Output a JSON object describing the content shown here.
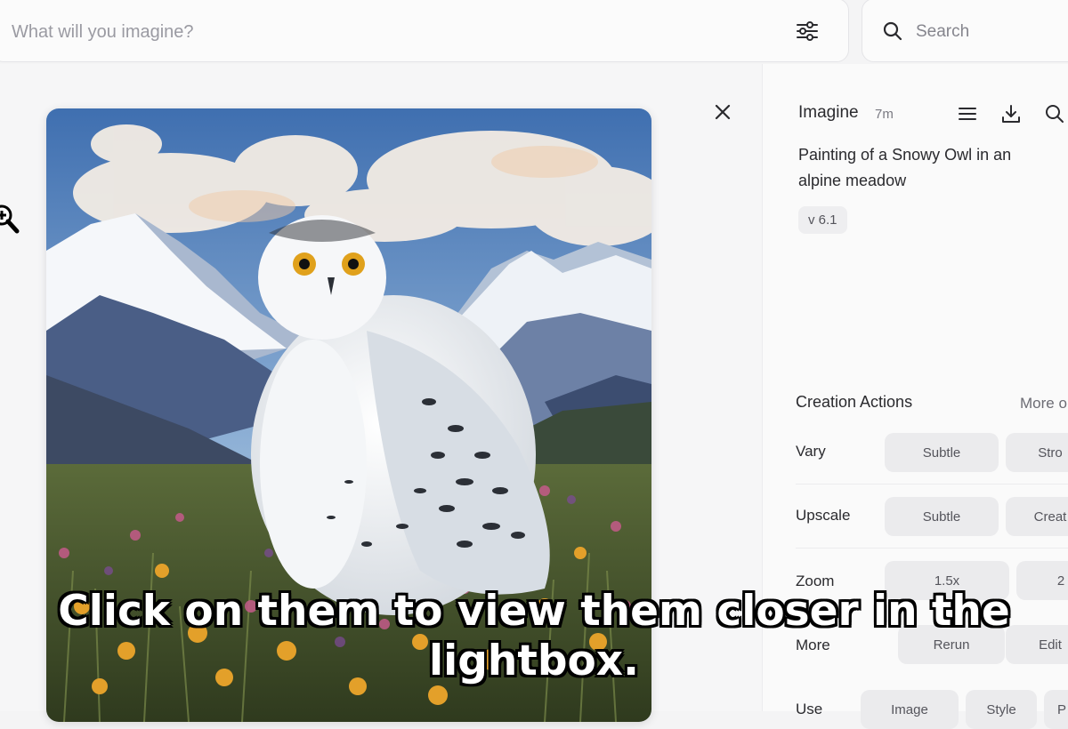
{
  "prompt_bar": {
    "placeholder": "What will you imagine?",
    "settings_icon": "sliders-icon"
  },
  "search": {
    "placeholder": "Search",
    "icon": "search-icon"
  },
  "lightbox": {
    "close_icon": "close-icon",
    "cursor_icon": "zoom-in-cursor-icon",
    "image_subject": "snowy owl painting"
  },
  "details": {
    "job_type": "Imagine",
    "job_age": "7m",
    "icons": [
      "menu-icon",
      "download-icon",
      "search-icon"
    ],
    "prompt": "Painting of a Snowy Owl in an alpine meadow",
    "version": "v 6.1",
    "creation_actions": {
      "title": "Creation Actions",
      "more_link": "More o",
      "rows": [
        {
          "label": "Vary",
          "buttons": [
            "Subtle",
            "Stro"
          ]
        },
        {
          "label": "Upscale",
          "buttons": [
            "Subtle",
            "Creat"
          ]
        },
        {
          "label": "Zoom",
          "buttons": [
            "1.5x",
            "2"
          ]
        },
        {
          "label": "More",
          "buttons": [
            "Rerun",
            "Edit"
          ]
        },
        {
          "label": "Use",
          "buttons": [
            "Image",
            "Style",
            "P"
          ]
        }
      ]
    }
  },
  "caption": {
    "line1": "Click on them to view them closer in the",
    "line2": "lightbox."
  }
}
